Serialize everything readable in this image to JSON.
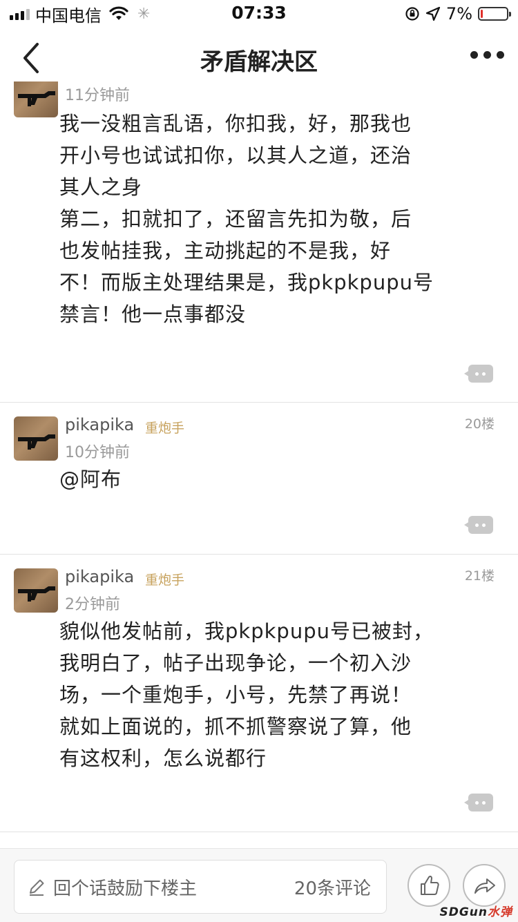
{
  "status_bar": {
    "carrier": "中国电信",
    "time": "07:33",
    "battery_percent": "7%",
    "battery_level": 0.07,
    "icons": [
      "signal-icon",
      "wifi-icon",
      "loading-icon",
      "orientation-lock-icon",
      "location-icon",
      "battery-icon"
    ]
  },
  "nav": {
    "title": "矛盾解决区",
    "back_icon": "chevron-left-icon",
    "more_icon": "more-dots-icon"
  },
  "comments": [
    {
      "time": "11分钟前",
      "lines": [
        "我一没粗言乱语，你扣我，好，那我也",
        "开小号也试试扣你，以其人之道，还治",
        "其人之身",
        "第二，扣就扣了，还留言先扣为敬，后",
        "也发帖挂我，主动挑起的不是我，好",
        "不！而版主处理结果是，我pkpkpupu号",
        "禁言！他一点事都没"
      ]
    },
    {
      "username": "pikapika",
      "badge": "重炮手",
      "floor": "20楼",
      "time": "10分钟前",
      "lines": [
        "@阿布"
      ]
    },
    {
      "username": "pikapika",
      "badge": "重炮手",
      "floor": "21楼",
      "time": "2分钟前",
      "lines": [
        "貌似他发帖前，我pkpkpupu号已被封，",
        "我明白了，帖子出现争论，一个初入沙",
        "场，一个重炮手，小号，先禁了再说！",
        "就如上面说的，抓不抓警察说了算，他",
        "有这权利，怎么说都行"
      ]
    }
  ],
  "bottom_bar": {
    "input_placeholder": "回个话鼓励下楼主",
    "comment_count": "20条评论",
    "like_icon": "thumbs-up-icon",
    "share_icon": "share-icon"
  },
  "watermark": {
    "text": "SDGun",
    "suffix": "水弹"
  },
  "colors": {
    "badge": "#c7a25d",
    "meta_text": "#9a9a9a",
    "battery_low": "#e0302a"
  }
}
